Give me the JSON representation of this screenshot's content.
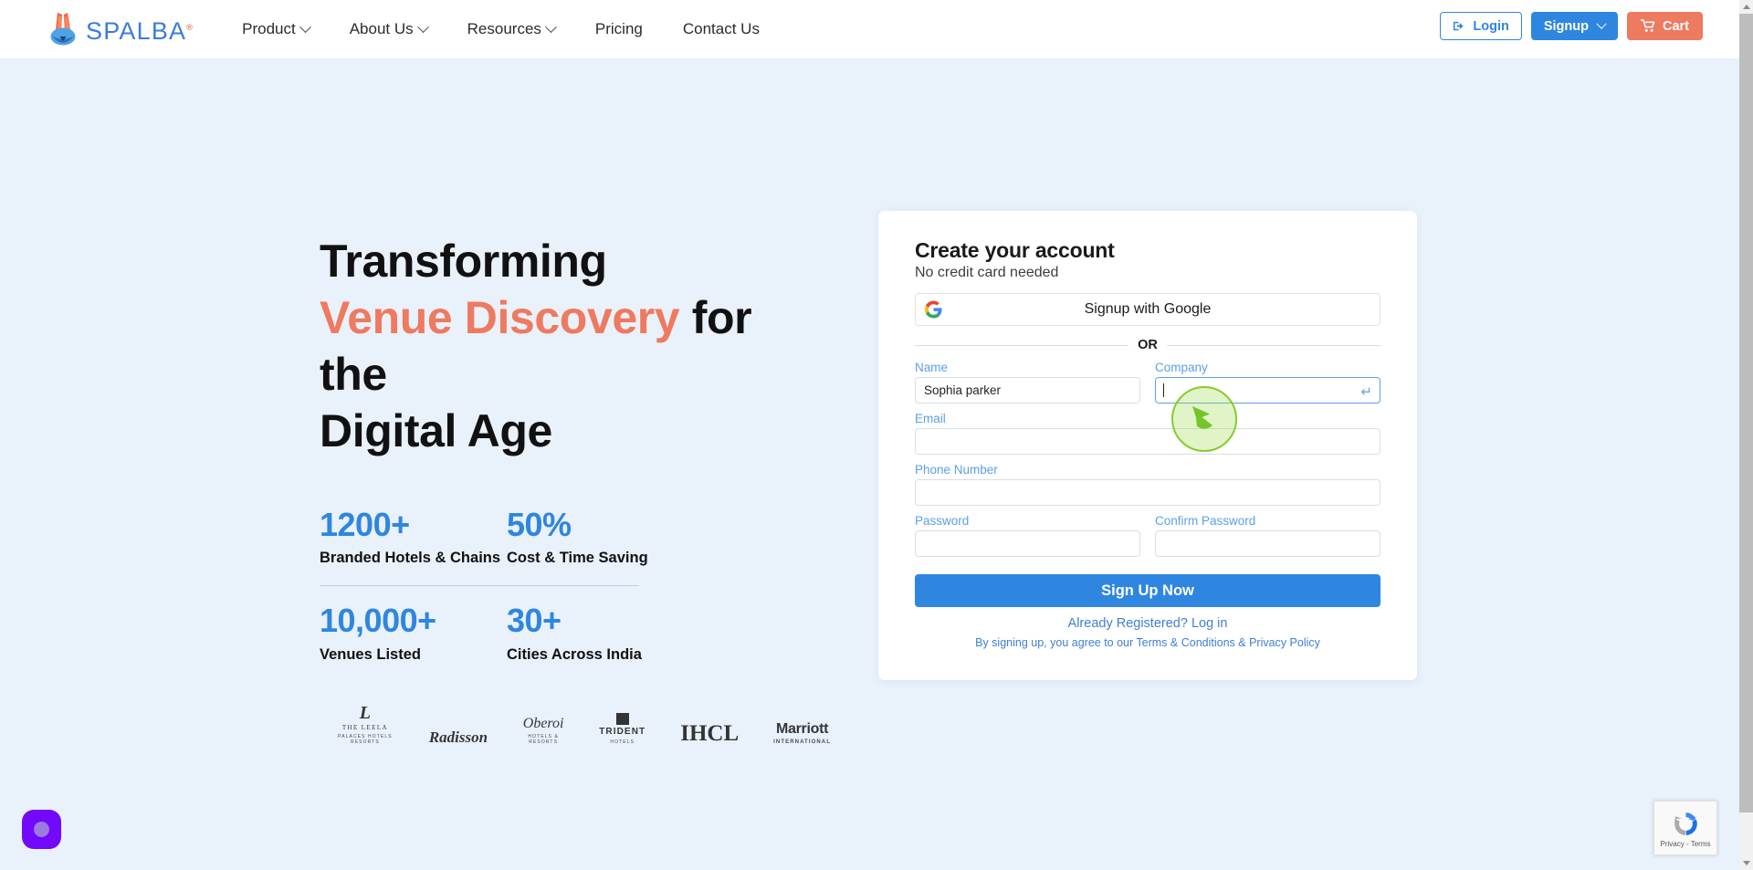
{
  "theme": {
    "brand_blue": "#2E86E0",
    "accent_coral": "#EE7A5F",
    "hero_bg": "#E9F1FB",
    "label_blue": "#5BA0E8",
    "link_blue": "#3E7FD4",
    "chat_purple": "#7209FA",
    "cursor_green": "#87CC2B"
  },
  "header": {
    "logo_text": "SPALBA",
    "logo_tm": "®",
    "nav": [
      {
        "label": "Product",
        "has_dropdown": true
      },
      {
        "label": "About Us",
        "has_dropdown": true
      },
      {
        "label": "Resources",
        "has_dropdown": true
      },
      {
        "label": "Pricing",
        "has_dropdown": false
      },
      {
        "label": "Contact Us",
        "has_dropdown": false
      }
    ],
    "actions": {
      "login_label": "Login",
      "login_icon": "sign-in-icon",
      "signup_label": "Signup",
      "signup_caret_icon": "chevron-down-icon",
      "cart_label": "Cart",
      "cart_icon": "shopping-cart-icon"
    }
  },
  "hero": {
    "title_line1": "Transforming",
    "title_accent": "Venue Discovery",
    "title_line2_rest": " for the",
    "title_line3": "Digital Age",
    "stats": [
      {
        "value": "1200+",
        "label": "Branded Hotels & Chains"
      },
      {
        "value": "50%",
        "label": "Cost & Time Saving"
      },
      {
        "value": "10,000+",
        "label": "Venues Listed"
      },
      {
        "value": "30+",
        "label": "Cities Across India"
      }
    ],
    "brands": [
      {
        "name": "THE LEELA",
        "mark": "L",
        "sub": "PALACES  HOTELS  RESORTS"
      },
      {
        "name": "Radisson",
        "mark": "Radisson",
        "sub": ""
      },
      {
        "name": "Oberoi",
        "mark": "Oberoi",
        "sub": "HOTELS & RESORTS"
      },
      {
        "name": "TRIDENT",
        "mark": "TRIDENT",
        "sub": "HOTELS"
      },
      {
        "name": "IHCL",
        "mark": "IHCL",
        "sub": ""
      },
      {
        "name": "Marriott",
        "mark": "Marriott",
        "sub": "INTERNATIONAL"
      }
    ]
  },
  "signup_card": {
    "title": "Create your account",
    "subtitle": "No credit card needed",
    "google_button_label": "Signup with Google",
    "google_icon": "google-g-icon",
    "divider_label": "OR",
    "fields": [
      {
        "label": "Name",
        "value": "Sophia parker",
        "placeholder": "",
        "type": "text",
        "focused": false
      },
      {
        "label": "Company",
        "value": "",
        "placeholder": "",
        "type": "text",
        "focused": true
      },
      {
        "label": "Email",
        "value": "",
        "placeholder": "",
        "type": "email",
        "focused": false
      },
      {
        "label": "Phone Number",
        "value": "",
        "placeholder": "",
        "type": "tel",
        "focused": false
      },
      {
        "label": "Password",
        "value": "",
        "placeholder": "",
        "type": "password",
        "focused": false
      },
      {
        "label": "Confirm Password",
        "value": "",
        "placeholder": "",
        "type": "password",
        "focused": false
      }
    ],
    "company_enter_icon": "return-enter-icon",
    "submit_label": "Sign Up Now",
    "login_link": "Already Registered? Log in",
    "terms_prefix": "By signing up, you agree to our ",
    "terms_link": "Terms & Conditions",
    "terms_amp": " & ",
    "privacy_link": "Privacy Policy"
  },
  "overlays": {
    "cursor_halo_name": "cursor-highlight",
    "cursor_arrow_name": "mouse-cursor-arrow",
    "chat_widget_name": "chat-launcher",
    "recaptcha_text": "Privacy - Terms",
    "recaptcha_logo": "recaptcha-logo"
  },
  "scrollbar": {
    "up_arrow": "scroll-up-arrow",
    "down_arrow": "scroll-down-arrow"
  }
}
